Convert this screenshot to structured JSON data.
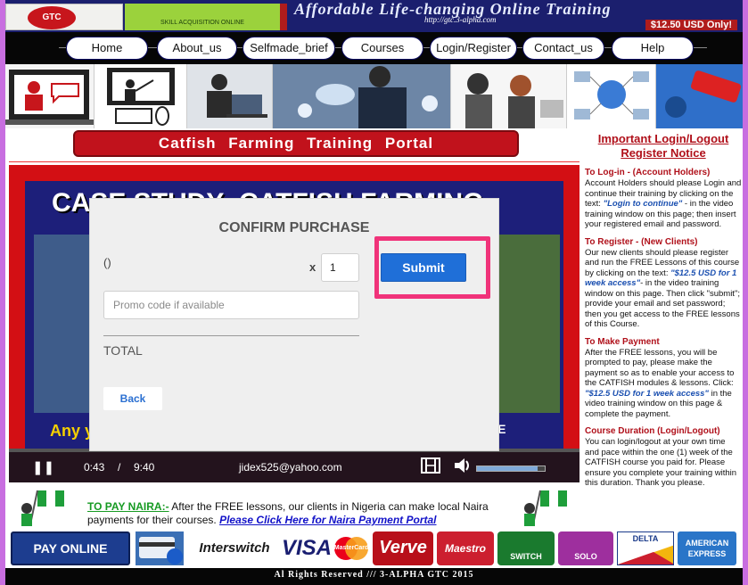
{
  "banner": {
    "logo_text": "GTC",
    "green_text": "SKILL ACQUISITION ONLINE",
    "tagline": "Affordable Life-changing Online Training",
    "site": "http://gtc.3-alpha.com",
    "price": "$12.50 USD Only!"
  },
  "nav": {
    "items": [
      "Home",
      "About_us",
      "Selfmade_brief",
      "Courses",
      "Login/Register",
      "Contact_us",
      "Help"
    ]
  },
  "portal_title": "Catfish Farming Training Portal",
  "video": {
    "headline": "CASE STUDY- CATFISH FARMING",
    "footer_left": "Any you",
    "footer_right": "DE",
    "current_time": "0:43",
    "separator": "/",
    "duration": "9:40",
    "user_email": "jidex525@yahoo.com",
    "progress": 0.0,
    "volume": 0.9
  },
  "modal": {
    "title": "CONFIRM PURCHASE",
    "product": "()",
    "qty_symbol": "x",
    "qty_value": "1",
    "promo_placeholder": "Promo code if available",
    "total_label": "TOTAL",
    "submit_label": "Submit",
    "back_label": "Back"
  },
  "right": {
    "notice": "Important Login/Logout Register Notice",
    "sections": [
      {
        "heading": "To Log-in - (Account Holders)",
        "body_pre": "Account Holders should please Login and continue their training by clicking on the text: ",
        "highlight": "\"Login to continue\"",
        "body_post": " - in the video training window on this page; then insert your registered email and password."
      },
      {
        "heading": "To Register - (New Clients)",
        "body_pre": "Our new clients should please register and run the FREE Lessons of this course by clicking on the text: ",
        "highlight": "\"$12.5 USD for 1 week access\"",
        "body_post": "- in the video training window on this page. Then click \"submit\"; provide your email and set password; then you get access to the FREE lessons of this Course."
      },
      {
        "heading": "To Make Payment",
        "body_pre": "After the FREE lessons, you will be prompted to pay, please make the payment so as to enable your access to the CATFISH modules & lessons. Click: ",
        "highlight": "\"$12.5 USD for 1 week access\"",
        "body_post": " in the video training window on this page & complete the payment."
      },
      {
        "heading": "Course Duration (Login/Logout)",
        "body_pre": "You can login/logout at your own time and pace within the one (1) week of the CATFISH course you paid for. Please ensure you complete your training within this duration. Thank you please.",
        "highlight": "",
        "body_post": ""
      }
    ]
  },
  "naira": {
    "label": "TO PAY NAIRA:-",
    "text": " After the FREE lessons, our clients in Nigeria can make local Naira payments for their courses. ",
    "link": "Please Click Here for Naira Payment Portal"
  },
  "payments": {
    "pay_online": "PAY ONLINE",
    "interswitch": "Interswitch",
    "visa": "VISA",
    "mastercard": "MasterCard",
    "verve": "Verve",
    "maestro": "Maestro",
    "switch": "SWITCH",
    "solo": "SOLO",
    "delta": "DELTA",
    "amex": "AMERICAN EXPRESS"
  },
  "footer": "Al Rights Reserved /// 3-ALPHA GTC 2015",
  "colors": {
    "brand_red": "#c1121c",
    "submit_blue": "#1f6fd8",
    "highlight_pink": "#f0337a",
    "naira_green": "#169a22"
  }
}
